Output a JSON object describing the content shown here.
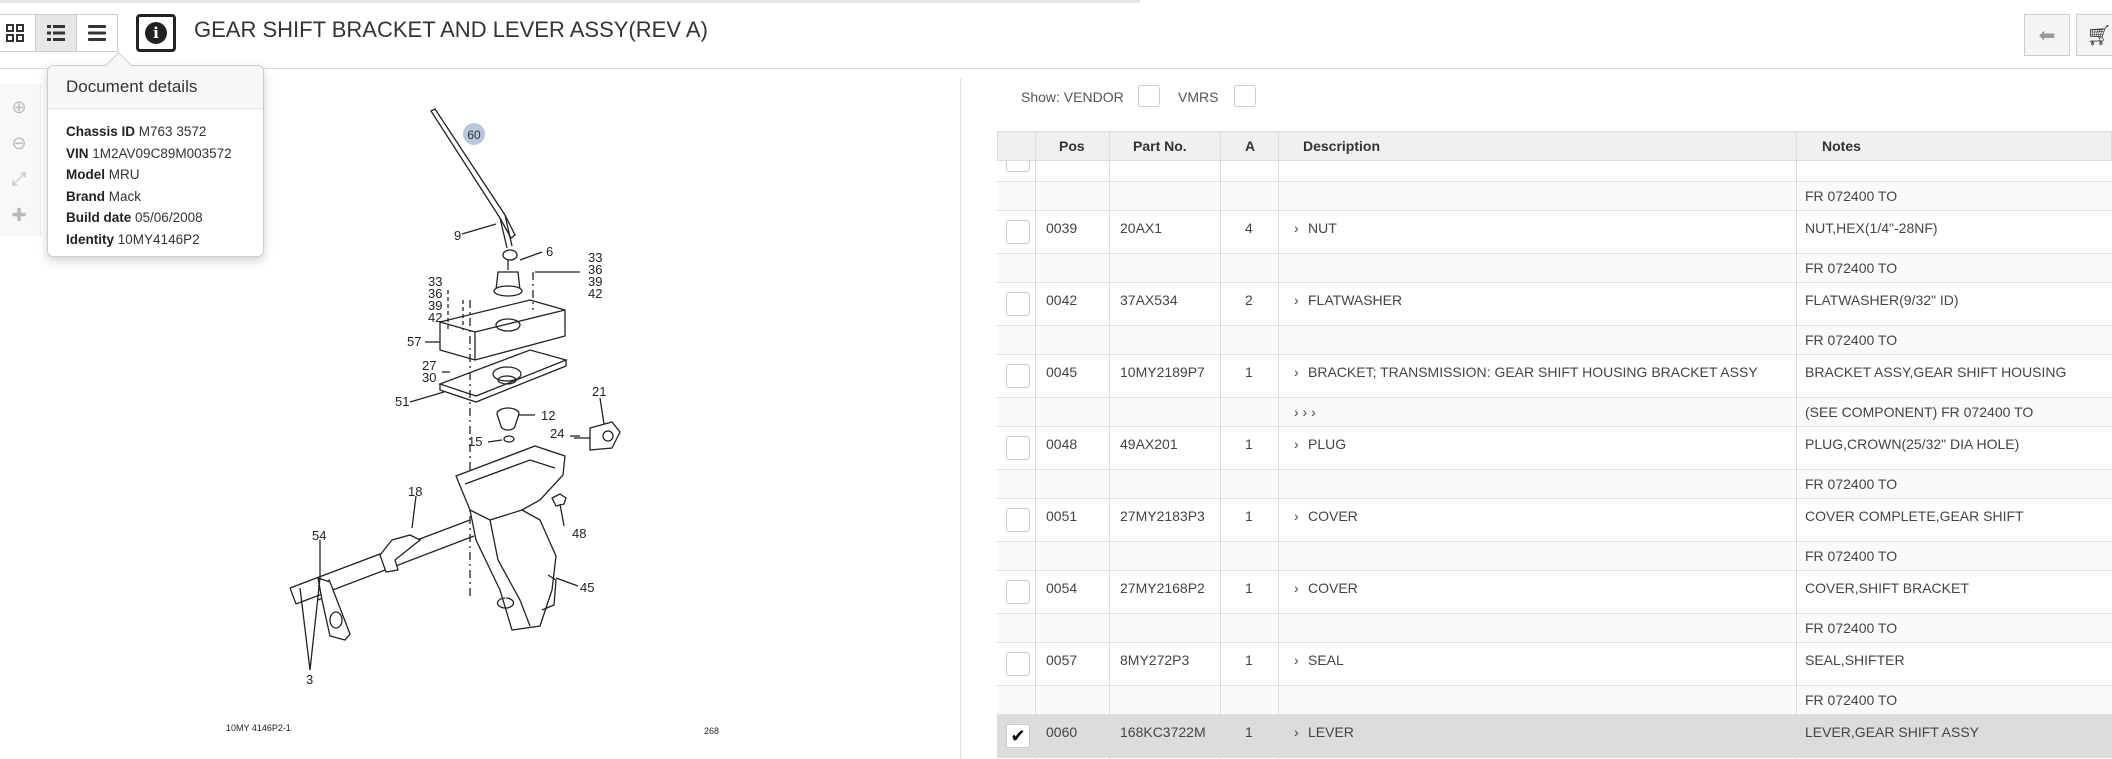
{
  "document": {
    "title": "GEAR SHIFT BRACKET AND LEVER ASSY(REV A)"
  },
  "toolbar": {
    "views": [
      "grid-view",
      "list-view",
      "detail-view"
    ],
    "info_icon": "i"
  },
  "popover": {
    "heading": "Document details",
    "fields": [
      {
        "label": "Chassis ID",
        "value": "M763 3572"
      },
      {
        "label": "VIN",
        "value": "1M2AV09C89M003572"
      },
      {
        "label": "Model",
        "value": "MRU"
      },
      {
        "label": "Brand",
        "value": "Mack"
      },
      {
        "label": "Build date",
        "value": "05/06/2008"
      },
      {
        "label": "Identity",
        "value": "10MY4146P2"
      }
    ]
  },
  "drawing": {
    "footer_left": "10MY 4146P2-1",
    "footer_right": "268",
    "highlight_label": "60",
    "callouts": [
      "9",
      "6",
      "33",
      "36",
      "39",
      "42",
      "33",
      "36",
      "39",
      "42",
      "57",
      "27",
      "30",
      "51",
      "12",
      "15",
      "24",
      "21",
      "18",
      "54",
      "48",
      "45",
      "3"
    ]
  },
  "filters": {
    "show_label": "Show: VENDOR",
    "vmrs_label": "VMRS"
  },
  "table": {
    "headers": {
      "pos": "Pos",
      "part": "Part No.",
      "a": "A",
      "desc": "Description",
      "notes": "Notes"
    },
    "top_sub": "FR 072400 TO",
    "rows": [
      {
        "pos": "0039",
        "part": "20AX1",
        "a": "4",
        "desc": "NUT",
        "notes": "NUT,HEX(1/4\"-28NF)",
        "sub_desc": "",
        "sub_notes": "FR 072400 TO",
        "checked": false
      },
      {
        "pos": "0042",
        "part": "37AX534",
        "a": "2",
        "desc": "FLATWASHER",
        "notes": "FLATWASHER(9/32\" ID)",
        "sub_desc": "",
        "sub_notes": "FR 072400 TO",
        "checked": false
      },
      {
        "pos": "0045",
        "part": "10MY2189P7",
        "a": "1",
        "desc": "BRACKET; TRANSMISSION: GEAR SHIFT HOUSING BRACKET ASSY",
        "notes": "BRACKET ASSY,GEAR SHIFT HOUSING",
        "sub_desc": "›   ›   ›",
        "sub_notes": "(SEE COMPONENT) FR 072400 TO",
        "checked": false
      },
      {
        "pos": "0048",
        "part": "49AX201",
        "a": "1",
        "desc": "PLUG",
        "notes": "PLUG,CROWN(25/32\" DIA HOLE)",
        "sub_desc": "",
        "sub_notes": "FR 072400 TO",
        "checked": false
      },
      {
        "pos": "0051",
        "part": "27MY2183P3",
        "a": "1",
        "desc": "COVER",
        "notes": "COVER COMPLETE,GEAR SHIFT",
        "sub_desc": "",
        "sub_notes": "FR 072400 TO",
        "checked": false
      },
      {
        "pos": "0054",
        "part": "27MY2168P2",
        "a": "1",
        "desc": "COVER",
        "notes": "COVER,SHIFT BRACKET",
        "sub_desc": "",
        "sub_notes": "FR 072400 TO",
        "checked": false
      },
      {
        "pos": "0057",
        "part": "8MY272P3",
        "a": "1",
        "desc": "SEAL",
        "notes": "SEAL,SHIFTER",
        "sub_desc": "",
        "sub_notes": "FR 072400 TO",
        "checked": false
      },
      {
        "pos": "0060",
        "part": "168KC3722M",
        "a": "1",
        "desc": "LEVER",
        "notes": "LEVER,GEAR SHIFT ASSY",
        "sub_desc": "",
        "sub_notes": "",
        "checked": true
      }
    ]
  },
  "icons": {
    "back": "arrow-left-icon",
    "cart": "cart-icon",
    "zoom_in": "zoom-in-icon",
    "zoom_out": "zoom-out-icon",
    "fit": "fit-screen-icon",
    "pan": "pan-icon"
  },
  "colors": {
    "highlight": "#b8c7de",
    "selected_row": "#dcdcdc"
  }
}
